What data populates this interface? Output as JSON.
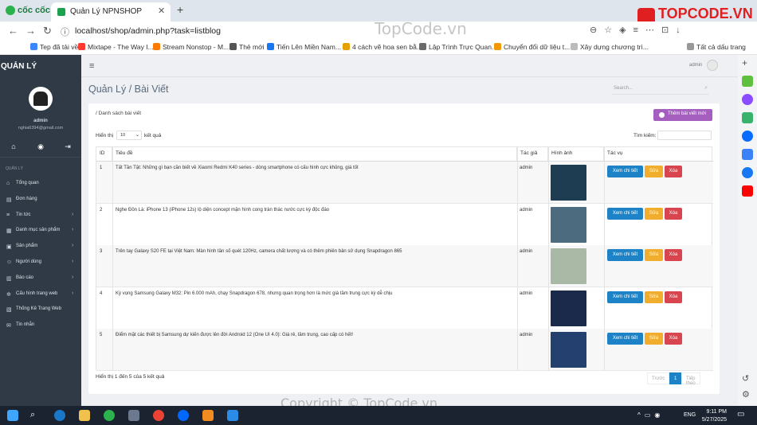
{
  "browser": {
    "name": "cốc cốc",
    "tab_title": "Quản Lý NPNSHOP",
    "url": "localhost/shop/admin.php?task=listblog",
    "bookmarks": [
      {
        "label": "Tep đã tải về",
        "color": "#3a86ff"
      },
      {
        "label": "Mixtape - The Way I...",
        "color": "#ff3b30"
      },
      {
        "label": "Stream Nonstop - M...",
        "color": "#ff7a00"
      },
      {
        "label": "Thẻ mới",
        "color": "#555555"
      },
      {
        "label": "Tiến Lên Miền Nam...",
        "color": "#1877f2"
      },
      {
        "label": "4 cách vẽ hoa sen bằ...",
        "color": "#e6a100"
      },
      {
        "label": "Lập Trình Trực Quan...",
        "color": "#6b6b6b"
      },
      {
        "label": "Chuyển đổi dữ liệu t...",
        "color": "#f29900"
      },
      {
        "label": "Xây dựng chương trì...",
        "color": "#bbbbbb"
      }
    ],
    "all_bookmarks_label": "Tất cả dấu trang",
    "watermark": "TopCode.vn",
    "brand_logo": "TOPCODE.VN"
  },
  "sidebar": {
    "title": "QUẢN LÝ",
    "username": "admin",
    "email": "nghia6394@gmail.com",
    "section_label": "QUẢN LÝ",
    "items": [
      {
        "icon": "⌂",
        "label": "Tổng quan",
        "arrow": false
      },
      {
        "icon": "▤",
        "label": "Đơn hàng",
        "arrow": false
      },
      {
        "icon": "≡",
        "label": "Tin tức",
        "arrow": true
      },
      {
        "icon": "▦",
        "label": "Danh mục sản phẩm",
        "arrow": true
      },
      {
        "icon": "▣",
        "label": "Sản phẩm",
        "arrow": true
      },
      {
        "icon": "☺",
        "label": "Người dùng",
        "arrow": true
      },
      {
        "icon": "▥",
        "label": "Báo cáo",
        "arrow": true
      },
      {
        "icon": "✲",
        "label": "Cấu hình trang web",
        "arrow": true
      },
      {
        "icon": "▧",
        "label": "Thống Kê Trang Web",
        "arrow": false
      },
      {
        "icon": "✉",
        "label": "Tin nhắn",
        "arrow": false
      }
    ]
  },
  "header": {
    "user": "admin",
    "page_heading": "Quản Lý / Bài Viết",
    "search_placeholder": "Search..."
  },
  "content": {
    "breadcrumb": "/ Danh sách bài viết",
    "add_button": "Thêm bài viết mới",
    "show_prefix": "Hiển thị",
    "page_length": "10",
    "show_suffix": "kết quả",
    "filter_label": "Tìm kiếm:",
    "columns": [
      "ID",
      "Tiêu đề",
      "Tác giả",
      "Hình ảnh",
      "Tác vụ"
    ],
    "rows": [
      {
        "id": "1",
        "title": "Tất Tần Tật: Những gì bạn cần biết về Xiaomi Redmi K40 series - dòng smartphone có cấu hình cực khủng, giá tốt",
        "author": "admin",
        "thumb_color": "#1f3d52"
      },
      {
        "id": "2",
        "title": "Nghe Đồn Là: iPhone 13 (iPhone 12s) lộ diện concept mặn hình cong tràn thác nước cực kỳ độc đáo",
        "author": "admin",
        "thumb_color": "#4d6b7f"
      },
      {
        "id": "3",
        "title": "Trên tay Galaxy S20 FE tại Việt Nam: Màn hình tần số quét 120Hz, camera chất lượng và có thêm phiên bản sử dụng Snapdragon 865",
        "author": "admin",
        "thumb_color": "#a9b9a6"
      },
      {
        "id": "4",
        "title": "Kỳ vọng Samsung Galaxy M32: Pin 6.000 mAh, chạy Snapdragon 678, nhưng quan trọng hơn là mức giá tầm trung cực kỳ dễ chịu",
        "author": "admin",
        "thumb_color": "#1b2a4a"
      },
      {
        "id": "5",
        "title": "Điểm mặt các thiết bị Samsung dự kiến được lên đời Android 12 (One UI 4.0): Giá rẻ, tầm trung, cao cấp có hết!",
        "author": "admin",
        "thumb_color": "#24406e"
      }
    ],
    "row_buttons": {
      "view": "Xem chi tiết",
      "edit": "Sửa",
      "delete": "Xóa"
    },
    "info": "Hiển thị 1 đến 5 của 5 kết quả",
    "pager": {
      "prev": "Trước",
      "current": "1",
      "next": "Tiếp theo"
    }
  },
  "taskbar": {
    "lang": "ENG",
    "time": "9:11 PM",
    "date": "5/27/2025"
  }
}
